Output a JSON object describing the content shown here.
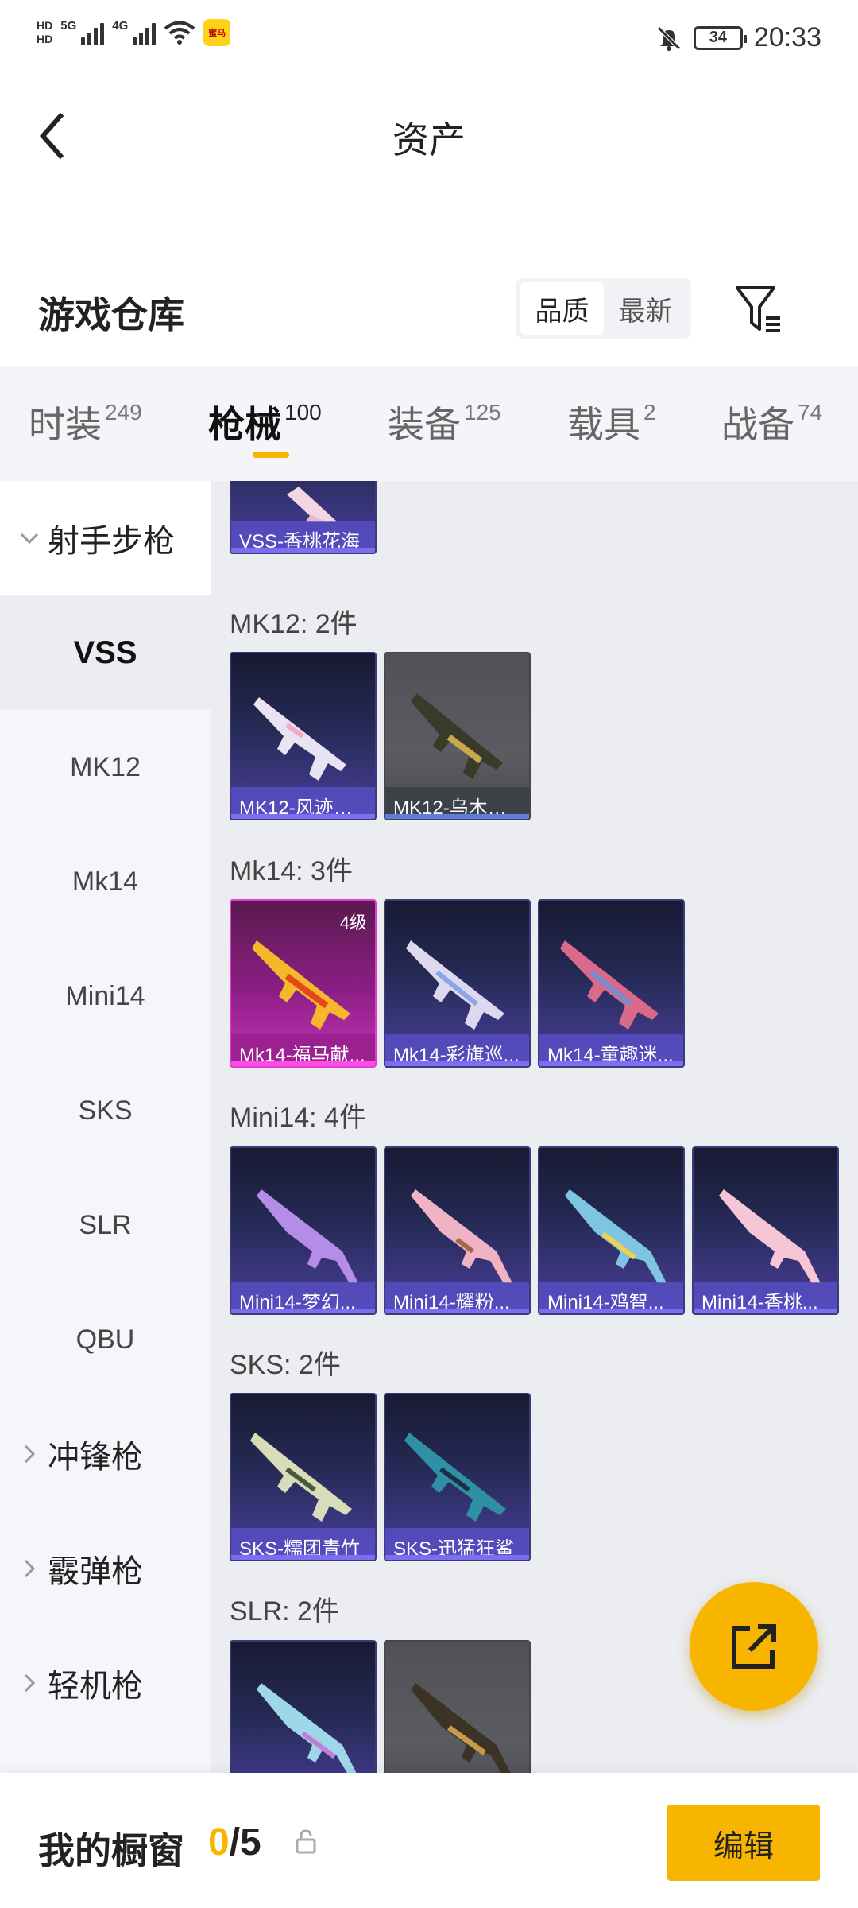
{
  "status_bar": {
    "hd_top": "HD",
    "hd_bottom": "HD",
    "network_5g": "5G",
    "network_4g": "4G",
    "app_badge": "蜜马",
    "battery": "34",
    "time": "20:33"
  },
  "header": {
    "title": "资产"
  },
  "warehouse": {
    "title": "游戏仓库",
    "sort_options": [
      "品质",
      "最新"
    ],
    "active_sort": "品质"
  },
  "tabs": [
    {
      "label": "时装",
      "count": "249"
    },
    {
      "label": "枪械",
      "count": "100"
    },
    {
      "label": "装备",
      "count": "125"
    },
    {
      "label": "载具",
      "count": "2"
    },
    {
      "label": "战备",
      "count": "74"
    }
  ],
  "active_tab": "枪械",
  "sidebar": {
    "group_open": "射手步枪",
    "items": [
      "VSS",
      "MK12",
      "Mk14",
      "Mini14",
      "SKS",
      "SLR",
      "QBU"
    ],
    "active_item": "VSS",
    "groups_closed": [
      "冲锋枪",
      "霰弹枪",
      "轻机枪"
    ]
  },
  "content": {
    "top_card": {
      "label": "VSS-香桃花海"
    },
    "groups": [
      {
        "title": "MK12: 2件",
        "cards": [
          {
            "label": "MK12-风迹短...",
            "style": "purple"
          },
          {
            "label": "MK12-乌木金...",
            "style": "gray"
          }
        ]
      },
      {
        "title": "Mk14: 3件",
        "cards": [
          {
            "label": "Mk14-福马献...",
            "style": "pink",
            "level": "4级"
          },
          {
            "label": "Mk14-彩旗巡...",
            "style": "purple"
          },
          {
            "label": "Mk14-童趣迷...",
            "style": "purple"
          }
        ]
      },
      {
        "title": "Mini14: 4件",
        "cards": [
          {
            "label": "Mini14-梦幻...",
            "style": "purple"
          },
          {
            "label": "Mini14-耀粉...",
            "style": "purple"
          },
          {
            "label": "Mini14-鸡智...",
            "style": "purple"
          },
          {
            "label": "Mini14-香桃...",
            "style": "purple"
          }
        ]
      },
      {
        "title": "SKS: 2件",
        "cards": [
          {
            "label": "SKS-糯团青竹",
            "style": "purple"
          },
          {
            "label": "SKS-迅猛狂鲨",
            "style": "purple"
          }
        ]
      },
      {
        "title": "SLR: 2件",
        "cards": [
          {
            "label": "",
            "style": "purple"
          },
          {
            "label": "",
            "style": "gray"
          }
        ]
      }
    ]
  },
  "bottom_bar": {
    "title": "我的橱窗",
    "current": "0",
    "total": "/5",
    "edit_label": "编辑"
  },
  "colors": {
    "accent": "#f8b500",
    "card_purple": "#4b3f9d",
    "card_pink": "#c535b7",
    "card_gray": "#5a5c62"
  }
}
